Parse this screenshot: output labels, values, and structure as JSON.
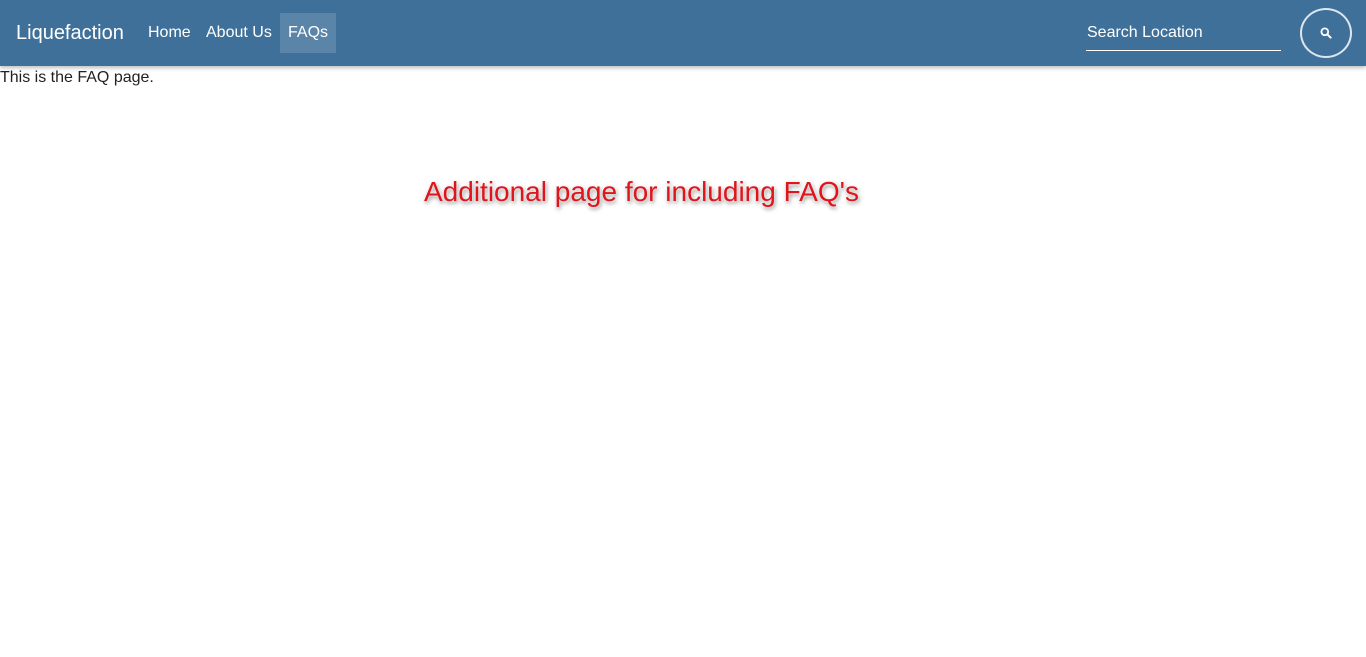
{
  "navbar": {
    "brand": "Liquefaction",
    "links": [
      {
        "label": "Home"
      },
      {
        "label": "About Us"
      },
      {
        "label": "FAQs",
        "active": true
      }
    ],
    "search": {
      "placeholder": "Search Location",
      "button_icon": "search-icon"
    },
    "colors": {
      "background": "#3e7099",
      "text": "#ffffff"
    }
  },
  "main": {
    "intro_text": "This is the FAQ page."
  },
  "annotation": {
    "text": "Additional page for including FAQ's",
    "color": "#e0141b"
  }
}
